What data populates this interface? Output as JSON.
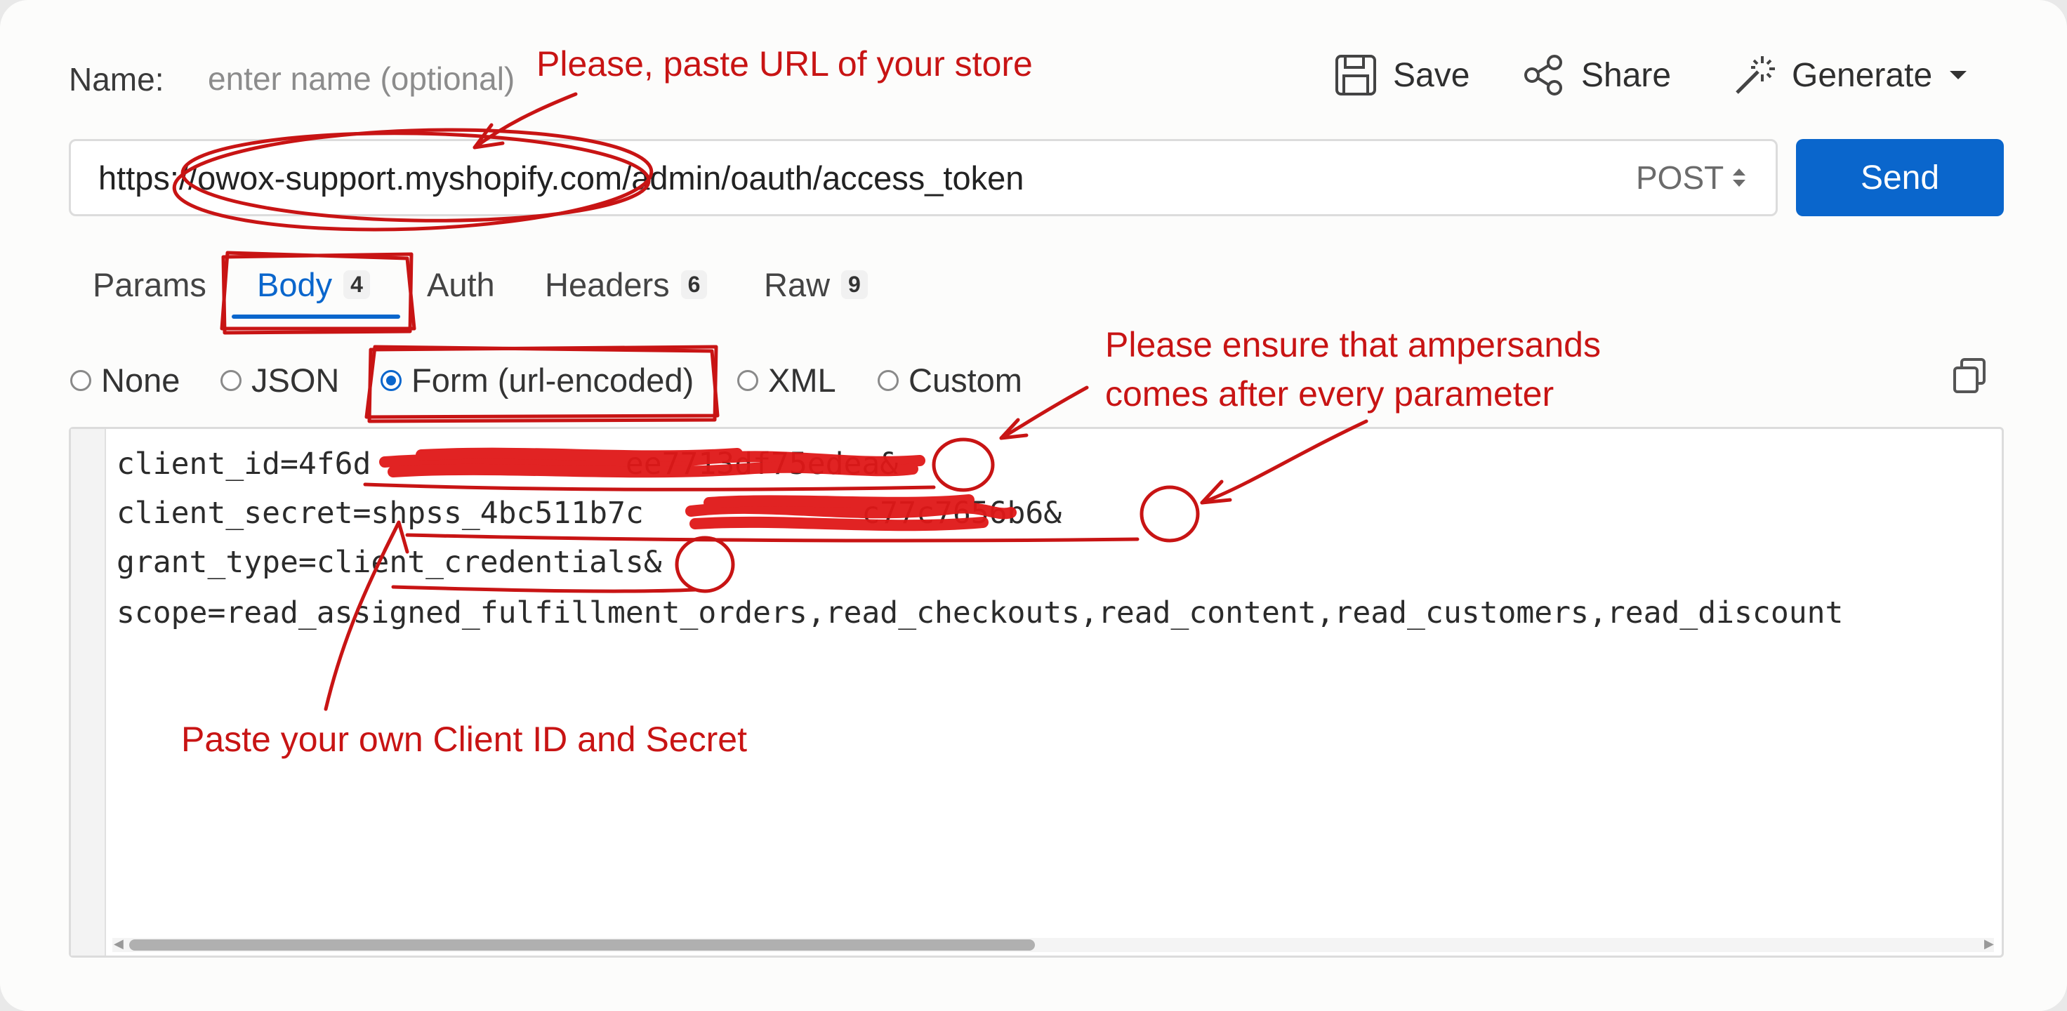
{
  "header": {
    "name_label": "Name:",
    "name_placeholder": "enter name (optional)",
    "save_label": "Save",
    "share_label": "Share",
    "generate_label": "Generate"
  },
  "request": {
    "url": "https://owox-support.myshopify.com/admin/oauth/access_token",
    "method": "POST",
    "send_label": "Send"
  },
  "tabs": [
    {
      "label": "Params",
      "badge": ""
    },
    {
      "label": "Body",
      "badge": "4"
    },
    {
      "label": "Auth",
      "badge": ""
    },
    {
      "label": "Headers",
      "badge": "6"
    },
    {
      "label": "Raw",
      "badge": "9"
    }
  ],
  "body_types": [
    "None",
    "JSON",
    "Form (url-encoded)",
    "XML",
    "Custom"
  ],
  "selected_body_type": "Form (url-encoded)",
  "body_lines": [
    "client_id=4f6d              ee7713df75edea&",
    "client_secret=shpss_4bc511b7c            c77c7656b6&",
    "grant_type=client_credentials&",
    "scope=read_assigned_fulfillment_orders,read_checkouts,read_content,read_customers,read_discount"
  ],
  "annotations": {
    "url_note": "Please, paste URL of your store",
    "ampersand_note_1": "Please ensure that ampersands",
    "ampersand_note_2": "comes after every parameter",
    "secret_note": "Paste your own Client ID and Secret"
  },
  "colors": {
    "accent": "#0a66cc",
    "annotation": "#c81414"
  }
}
